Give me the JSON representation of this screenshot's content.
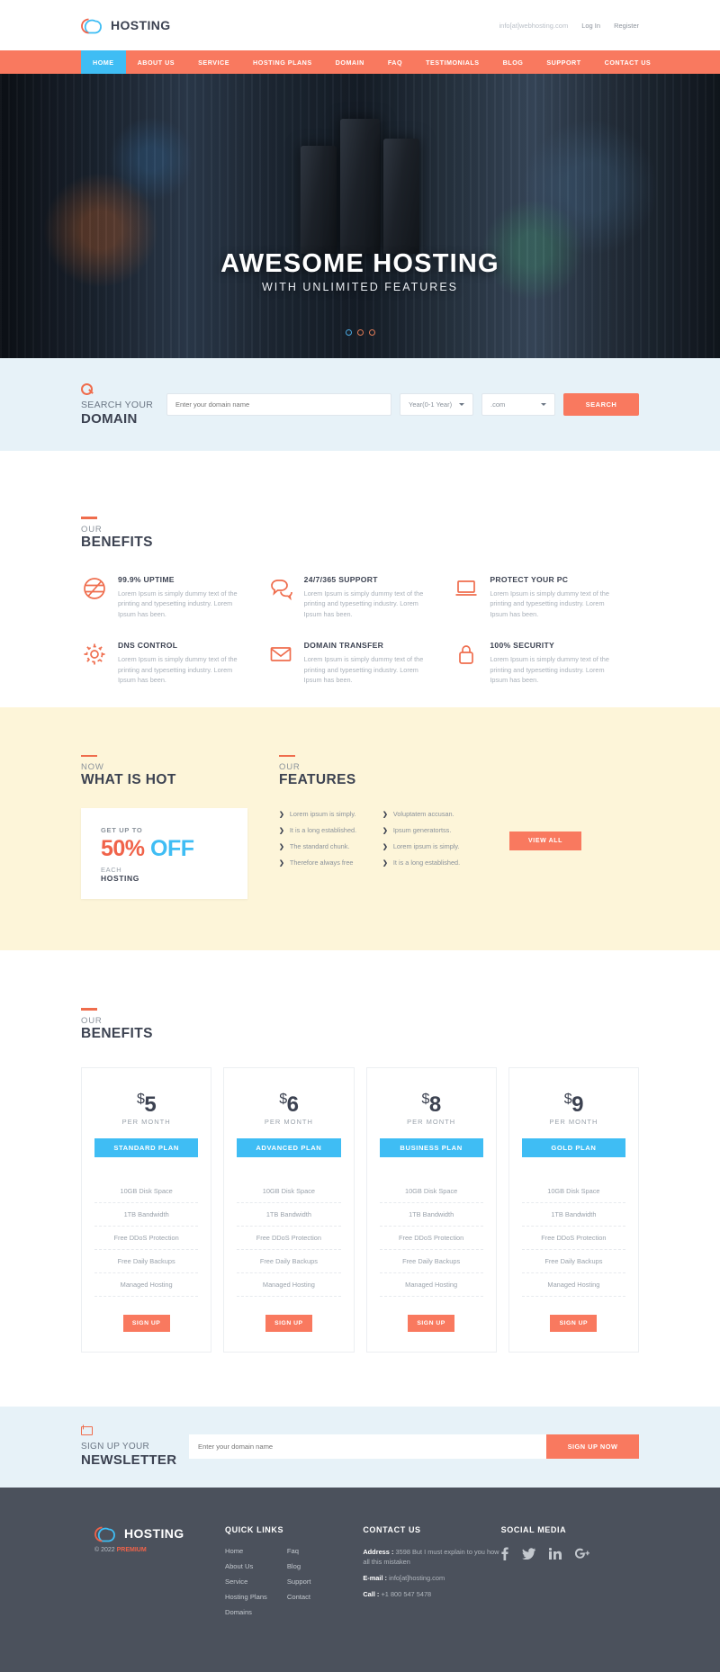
{
  "brand": {
    "name": "HOSTING",
    "icon": "cloud-icon"
  },
  "topbar": {
    "email": "info[at]webhosting.com",
    "login": "Log In",
    "register": "Register"
  },
  "nav": {
    "items": [
      {
        "label": "HOME",
        "active": true
      },
      {
        "label": "ABOUT US",
        "active": false
      },
      {
        "label": "SERVICE",
        "active": false
      },
      {
        "label": "HOSTING PLANS",
        "active": false
      },
      {
        "label": "DOMAIN",
        "active": false
      },
      {
        "label": "FAQ",
        "active": false
      },
      {
        "label": "TESTIMONIALS",
        "active": false
      },
      {
        "label": "BLOG",
        "active": false
      },
      {
        "label": "SUPPORT",
        "active": false
      },
      {
        "label": "CONTACT US",
        "active": false
      }
    ]
  },
  "hero": {
    "title": "AWESOME HOSTING",
    "subtitle": "WITH UNLIMITED FEATURES",
    "slide_count": 3,
    "active_slide": 1
  },
  "search": {
    "label_small": "SEARCH YOUR",
    "label_big": "DOMAIN",
    "placeholder": "Enter your domain name",
    "year_value": "Year(0-1 Year)",
    "tld_value": ".com",
    "button": "SEARCH"
  },
  "benefits": {
    "heading_small": "OUR",
    "heading_big": "BENEFITS",
    "items": [
      {
        "icon": "uptime-icon",
        "title": "99.9% UPTIME",
        "text": "Lorem Ipsum is simply dummy text of the printing and typesetting industry. Lorem Ipsum has been."
      },
      {
        "icon": "chat-bubble-icon",
        "title": "24/7/365 SUPPORT",
        "text": "Lorem Ipsum is simply dummy text of the printing and typesetting industry. Lorem Ipsum has been."
      },
      {
        "icon": "laptop-icon",
        "title": "PROTECT YOUR PC",
        "text": "Lorem Ipsum is simply dummy text of the printing and typesetting industry. Lorem Ipsum has been."
      },
      {
        "icon": "gear-icon",
        "title": "DNS CONTROL",
        "text": "Lorem Ipsum is simply dummy text of the printing and typesetting industry. Lorem Ipsum has been."
      },
      {
        "icon": "envelope-icon",
        "title": "DOMAIN TRANSFER",
        "text": "Lorem Ipsum is simply dummy text of the printing and typesetting industry. Lorem Ipsum has been."
      },
      {
        "icon": "lock-icon",
        "title": "100% SECURITY",
        "text": "Lorem Ipsum is simply dummy text of the printing and typesetting industry. Lorem Ipsum has been."
      }
    ]
  },
  "hot": {
    "heading_small": "NOW",
    "heading_big": "WHAT IS HOT",
    "card": {
      "line1": "GET UP TO",
      "percent": "50%",
      "off": "OFF",
      "line3": "EACH",
      "line4": "HOSTING"
    }
  },
  "features": {
    "heading_small": "OUR",
    "heading_big": "FEATURES",
    "col1": [
      "Lorem ipsum is simply.",
      "It is a long established.",
      "The standard chunk.",
      "Therefore always free"
    ],
    "col2": [
      "Voluptatem accusan.",
      "Ipsum generatortss.",
      "Lorem ipsum is simply.",
      "It is a long established."
    ],
    "view_all": "VIEW ALL"
  },
  "pricing": {
    "heading_small": "OUR",
    "heading_big": "BENEFITS",
    "per_month": "PER MONTH",
    "currency": "$",
    "signup": "SIGN UP",
    "plans": [
      {
        "price": "5",
        "name": "STANDARD PLAN",
        "features": [
          "10GB Disk Space",
          "1TB Bandwidth",
          "Free DDoS Protection",
          "Free Daily Backups",
          "Managed Hosting"
        ]
      },
      {
        "price": "6",
        "name": "ADVANCED PLAN",
        "features": [
          "10GB Disk Space",
          "1TB Bandwidth",
          "Free DDoS Protection",
          "Free Daily Backups",
          "Managed Hosting"
        ]
      },
      {
        "price": "8",
        "name": "BUSINESS PLAN",
        "features": [
          "10GB Disk Space",
          "1TB Bandwidth",
          "Free DDoS Protection",
          "Free Daily Backups",
          "Managed Hosting"
        ]
      },
      {
        "price": "9",
        "name": "GOLD PLAN",
        "features": [
          "10GB Disk Space",
          "1TB Bandwidth",
          "Free DDoS Protection",
          "Free Daily Backups",
          "Managed Hosting"
        ]
      }
    ]
  },
  "newsletter": {
    "icon": "envelope-icon",
    "label_small": "SIGN UP YOUR",
    "label_big": "NEWSLETTER",
    "placeholder": "Enter your domain name",
    "button": "SIGN UP NOW"
  },
  "footer": {
    "copyright_prefix": "© 2022",
    "copyright_mark": "PREMIUM",
    "quick_links": {
      "heading": "QUICK LINKS",
      "col1": [
        "Home",
        "About Us",
        "Service",
        "Hosting Plans",
        "Domains"
      ],
      "col2": [
        "Faq",
        "Blog",
        "Support",
        "Contact"
      ]
    },
    "contact": {
      "heading": "CONTACT US",
      "address_label": "Address :",
      "address_value": "3598 But I must explain to you how all this mistaken",
      "email_label": "E-mail :",
      "email_value": "info[at]hosting.com",
      "call_label": "Call :",
      "call_value": "+1 800 547 5478"
    },
    "social": {
      "heading": "SOCIAL MEDIA",
      "items": [
        {
          "name": "facebook-icon",
          "glyph": "f"
        },
        {
          "name": "twitter-icon",
          "glyph": "🐦"
        },
        {
          "name": "linkedin-icon",
          "glyph": "in"
        },
        {
          "name": "google-plus-icon",
          "glyph": "g+"
        }
      ]
    }
  },
  "colors": {
    "orange": "#f9795f",
    "orange_dark": "#ef6d4d",
    "blue": "#3fbdf4",
    "dark": "#3c4251",
    "footer_bg": "#4b515c",
    "pale_blue": "#e7f2f8",
    "cream": "#fdf5d9"
  }
}
